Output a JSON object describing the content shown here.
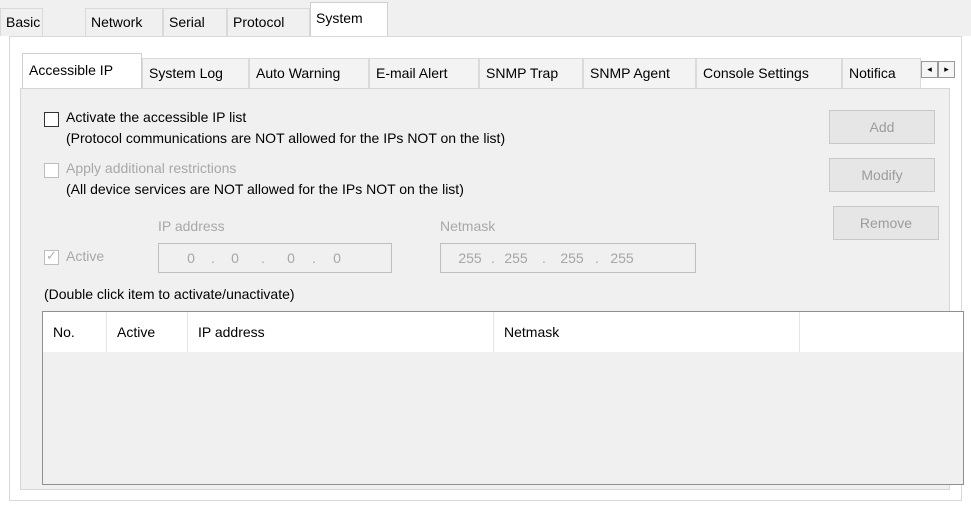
{
  "top_tabs": [
    "Basic",
    "Network",
    "Serial",
    "Protocol",
    "System"
  ],
  "sub_tabs": [
    "Accessible IP",
    "System Log",
    "Auto Warning",
    "E-mail Alert",
    "SNMP Trap",
    "SNMP Agent",
    "Console Settings",
    "Notifica"
  ],
  "scroll": {
    "left": "◂",
    "right": "▸"
  },
  "activate_list": {
    "label": "Activate the accessible IP list",
    "note": "(Protocol communications are NOT allowed for the IPs NOT on the list)"
  },
  "restrictions": {
    "label": "Apply additional restrictions",
    "note": "(All device services are NOT allowed for the IPs NOT on the list)"
  },
  "entry": {
    "ip_label": "IP address",
    "mask_label": "Netmask",
    "active_label": "Active",
    "ip": [
      "0",
      "0",
      "0",
      "0"
    ],
    "mask": [
      "255",
      "255",
      "255",
      "255"
    ],
    "dot": "."
  },
  "buttons": {
    "add": "Add",
    "modify": "Modify",
    "remove": "Remove"
  },
  "hint": "(Double click item to activate/unactivate)",
  "table": {
    "columns": [
      "No.",
      "Active",
      "IP address",
      "Netmask"
    ]
  }
}
